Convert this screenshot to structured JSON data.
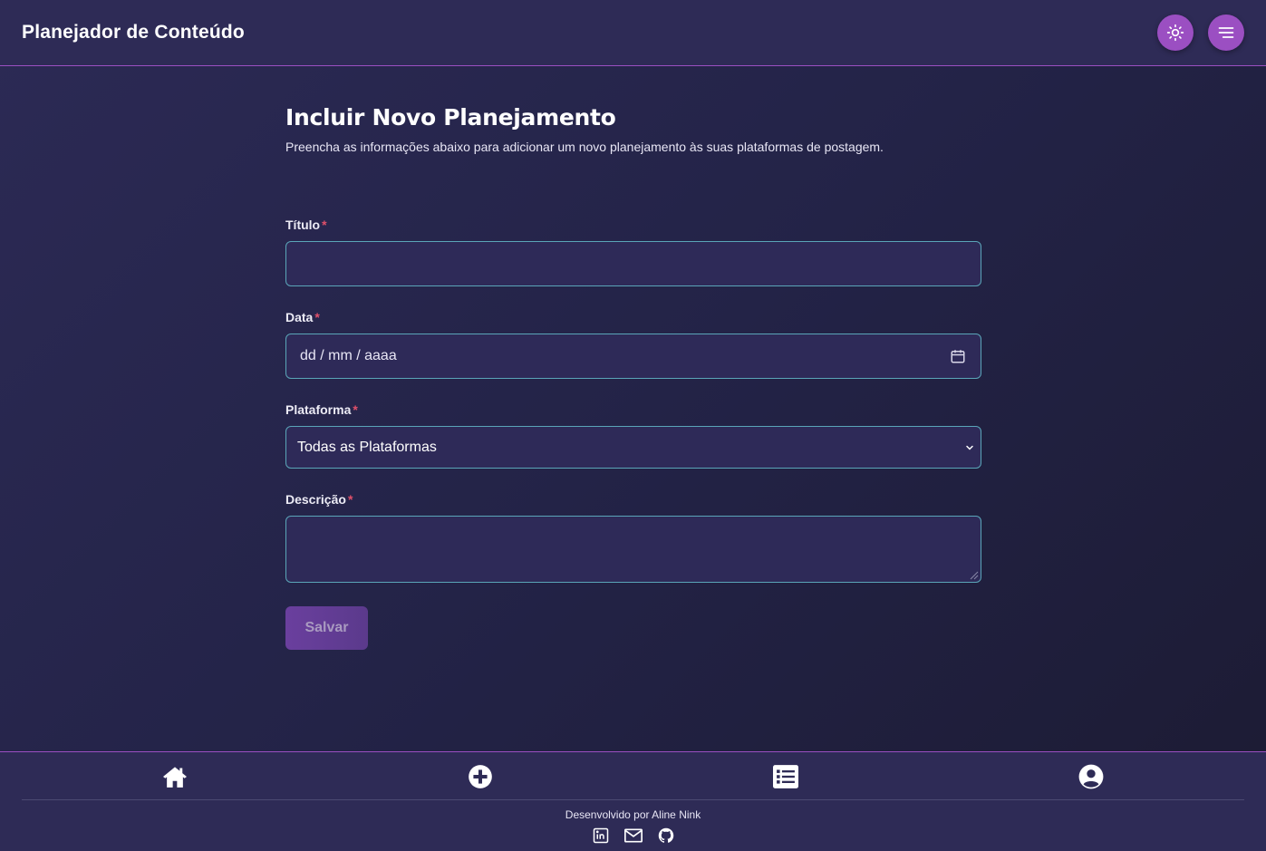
{
  "header": {
    "title": "Planejador de Conteúdo",
    "theme_icon": "sun-icon",
    "menu_icon": "hamburger-menu-icon"
  },
  "form": {
    "title": "Incluir Novo Planejamento",
    "subtitle": "Preencha as informações abaixo para adicionar um novo planejamento às suas plataformas de postagem.",
    "required_mark": "*",
    "fields": {
      "titulo": {
        "label": "Título",
        "value": ""
      },
      "data": {
        "label": "Data",
        "placeholder": "dd / mm / aaaa",
        "icon": "calendar-icon"
      },
      "plataforma": {
        "label": "Plataforma",
        "selected": "Todas as Plataformas",
        "icon": "chevron-down-icon"
      },
      "descricao": {
        "label": "Descrição",
        "value": ""
      }
    },
    "save_label": "Salvar"
  },
  "bottom_nav": {
    "items": [
      {
        "icon": "home-icon"
      },
      {
        "icon": "plus-circle-icon"
      },
      {
        "icon": "list-icon"
      },
      {
        "icon": "user-circle-icon"
      }
    ]
  },
  "footer": {
    "credit": "Desenvolvido por Aline Nink",
    "social": [
      {
        "icon": "linkedin-icon"
      },
      {
        "icon": "email-icon"
      },
      {
        "icon": "github-icon"
      }
    ]
  },
  "colors": {
    "accent": "#9b4fc2",
    "background": "#232347",
    "input_border": "#5aa5b8",
    "required": "#e0506a"
  }
}
